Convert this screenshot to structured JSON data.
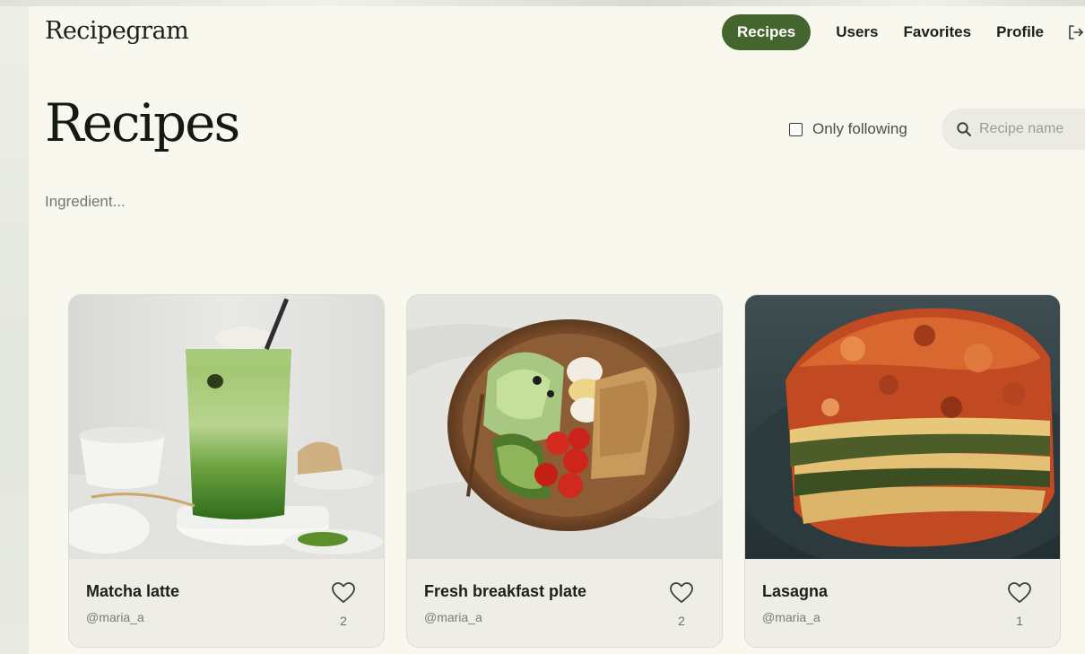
{
  "app": {
    "brand": "Recipegram"
  },
  "nav": {
    "items": [
      {
        "label": "Recipes",
        "active": true
      },
      {
        "label": "Users",
        "active": false
      },
      {
        "label": "Favorites",
        "active": false
      },
      {
        "label": "Profile",
        "active": false
      }
    ],
    "logout_icon": "logout-icon"
  },
  "page": {
    "title": "Recipes"
  },
  "filters": {
    "only_following_label": "Only following",
    "only_following_checked": false,
    "search_placeholder": "Recipe name",
    "search_value": "",
    "ingredient_placeholder": "Ingredient...",
    "ingredient_value": ""
  },
  "recipes": [
    {
      "title": "Matcha latte",
      "author": "@maria_a",
      "likes": "2"
    },
    {
      "title": "Fresh breakfast plate",
      "author": "@maria_a",
      "likes": "2"
    },
    {
      "title": "Lasagna",
      "author": "@maria_a",
      "likes": "1"
    }
  ],
  "colors": {
    "accent": "#45652f",
    "background": "#f8f8ef",
    "card": "#eeeee6"
  }
}
